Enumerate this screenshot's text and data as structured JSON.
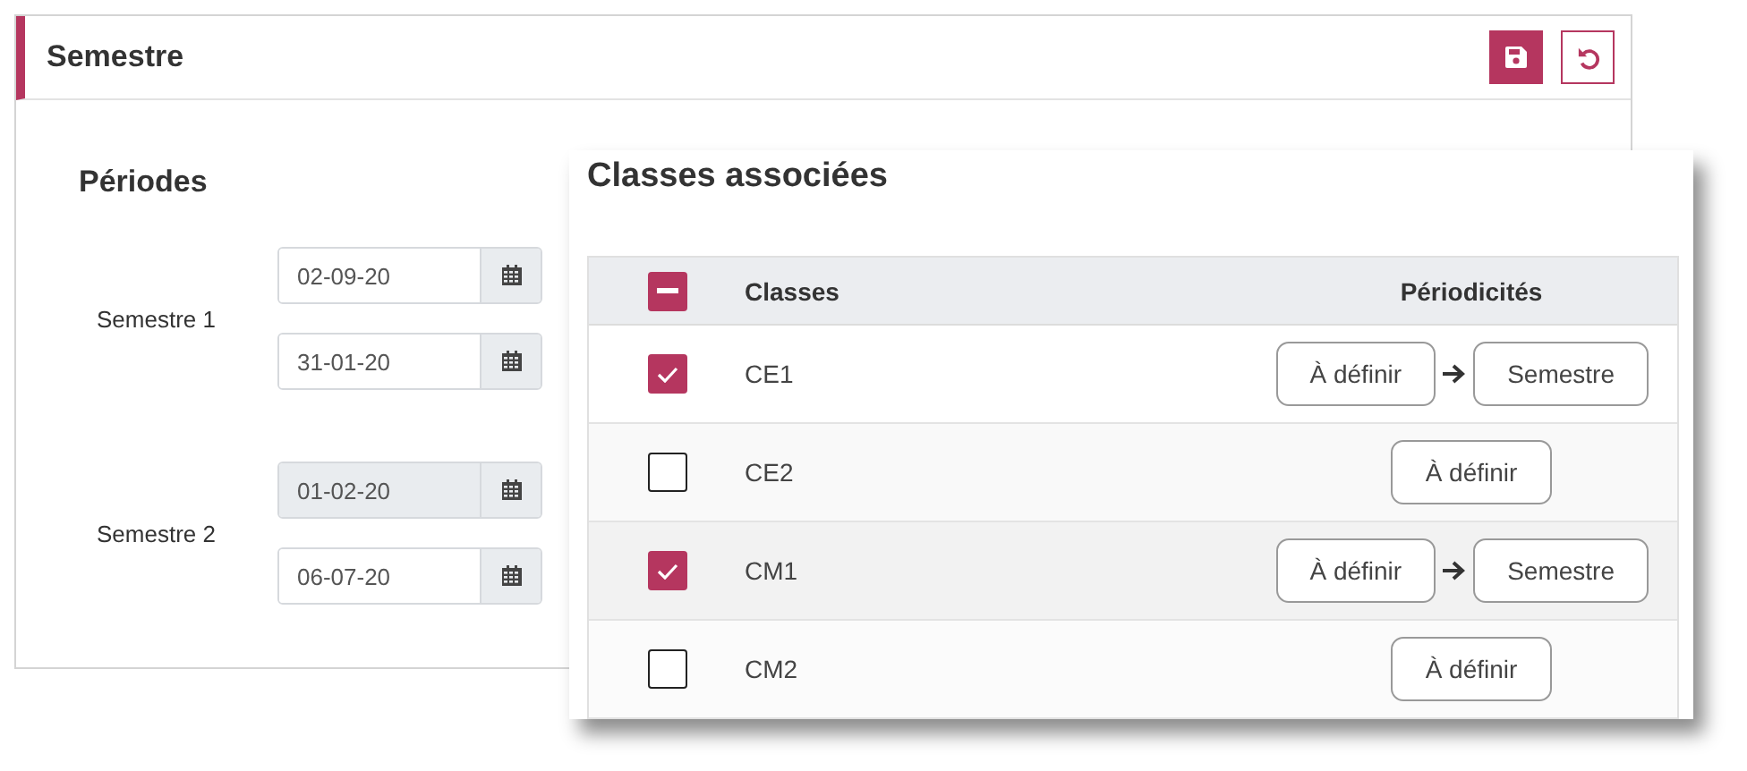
{
  "card": {
    "title": "Semestre",
    "section_title": "Périodes",
    "periods": [
      {
        "label": "Semestre 1",
        "start": {
          "value": "02-09-20",
          "disabled": false
        },
        "end": {
          "value": "31-01-20",
          "disabled": false
        }
      },
      {
        "label": "Semestre 2",
        "start": {
          "value": "01-02-20",
          "disabled": true
        },
        "end": {
          "value": "06-07-20",
          "disabled": false
        }
      }
    ]
  },
  "dialog": {
    "title": "Classes associées",
    "columns": [
      "Classes",
      "Périodicités"
    ],
    "select_all": {
      "indeterminate": true
    },
    "rows": [
      {
        "name": "CE1",
        "checked": true,
        "from": "À définir",
        "to": "Semestre"
      },
      {
        "name": "CE2",
        "checked": false,
        "from": "À définir"
      },
      {
        "name": "CM1",
        "checked": true,
        "from": "À définir",
        "to": "Semestre"
      },
      {
        "name": "CM2",
        "checked": false,
        "from": "À définir"
      }
    ]
  }
}
